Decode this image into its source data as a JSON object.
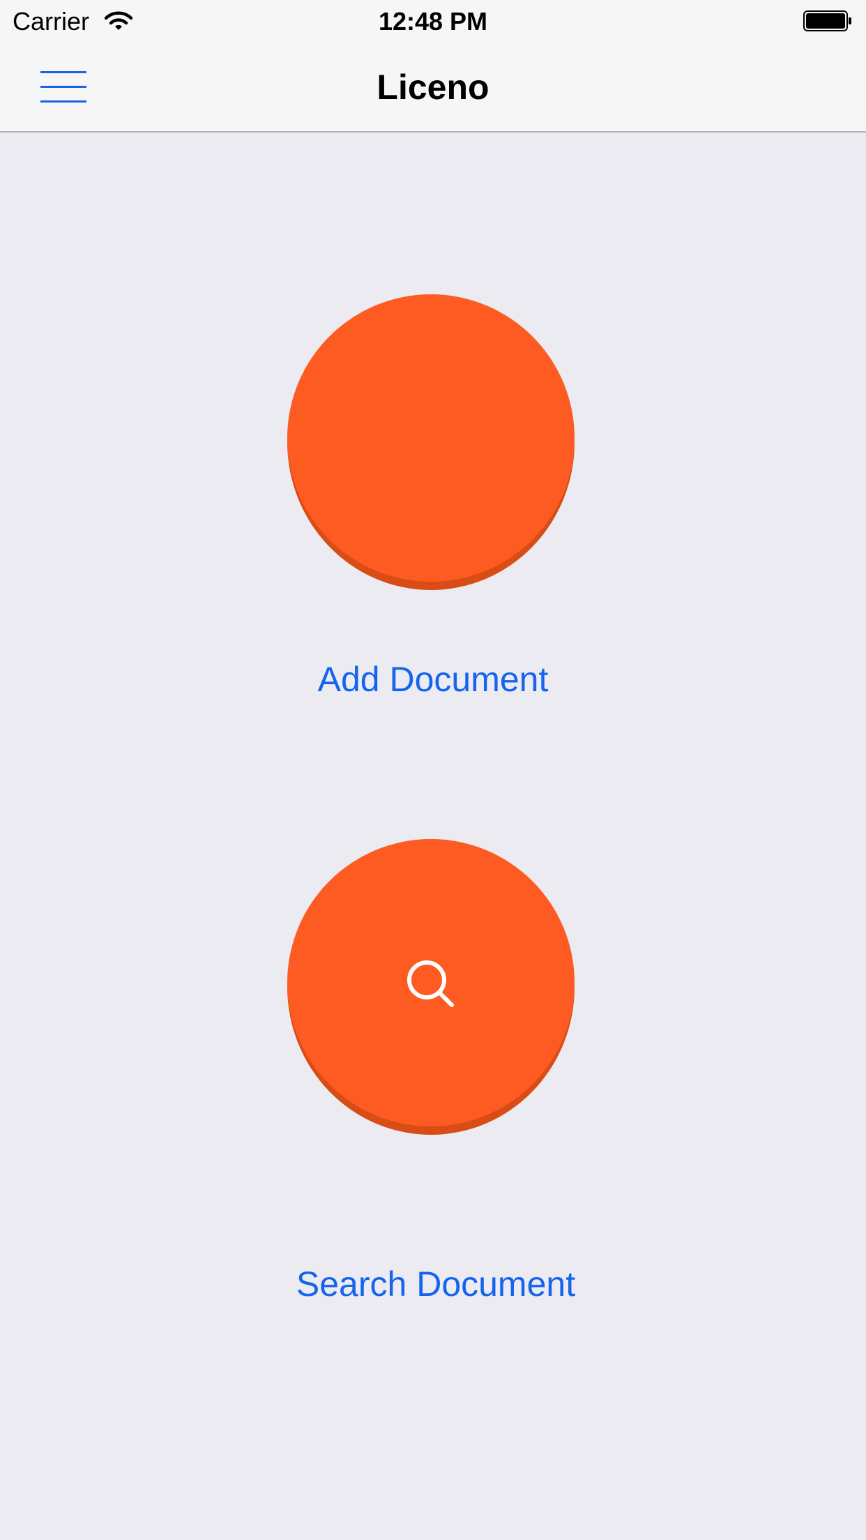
{
  "status_bar": {
    "carrier": "Carrier",
    "time": "12:48 PM"
  },
  "nav": {
    "title": "Liceno",
    "menu_icon": "hamburger-menu-icon"
  },
  "actions": {
    "add": {
      "label": "Add Document",
      "icon": "blank-circle"
    },
    "search": {
      "label": "Search Document",
      "icon": "search-icon"
    }
  },
  "colors": {
    "accent": "#FE5B22",
    "accent_shadow": "#D94C16",
    "link": "#1464EE",
    "background": "#ECEBF1",
    "bar": "#F6F6F7"
  }
}
